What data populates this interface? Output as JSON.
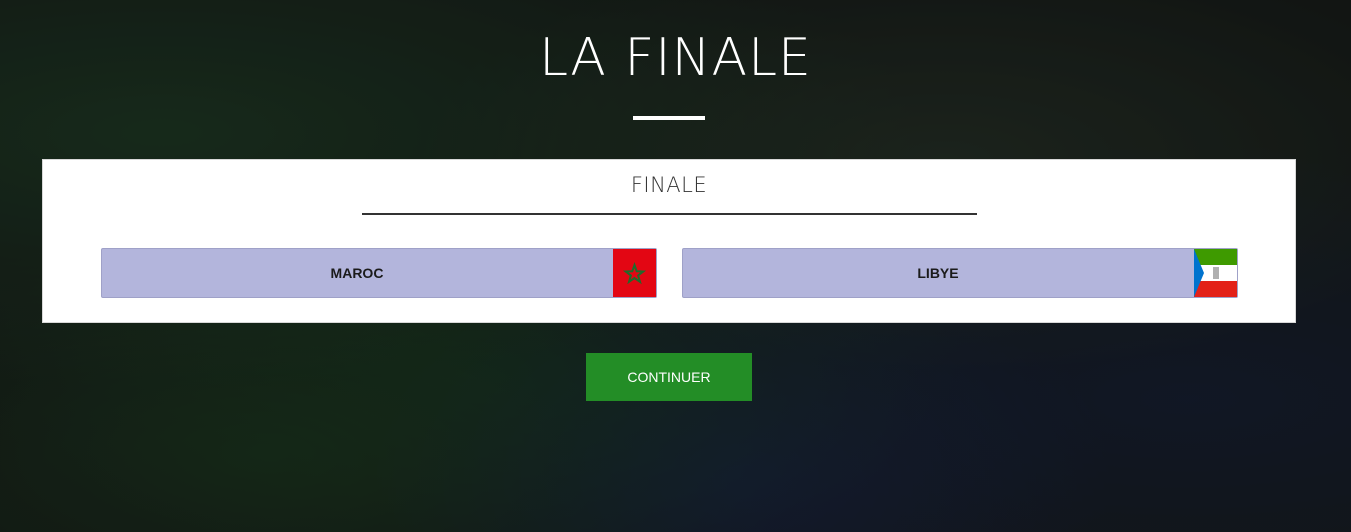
{
  "page": {
    "title": "LA FINALE"
  },
  "card": {
    "title": "FINALE"
  },
  "teams": [
    {
      "name": "MAROC",
      "flag_icon": "morocco-flag-icon"
    },
    {
      "name": "LIBYE",
      "flag_icon": "equatorial-guinea-flag-icon"
    }
  ],
  "actions": {
    "continue_label": "CONTINUER"
  },
  "colors": {
    "team_background": "#b3b5dc",
    "continue_button": "#238d26",
    "card_background": "#ffffff"
  }
}
